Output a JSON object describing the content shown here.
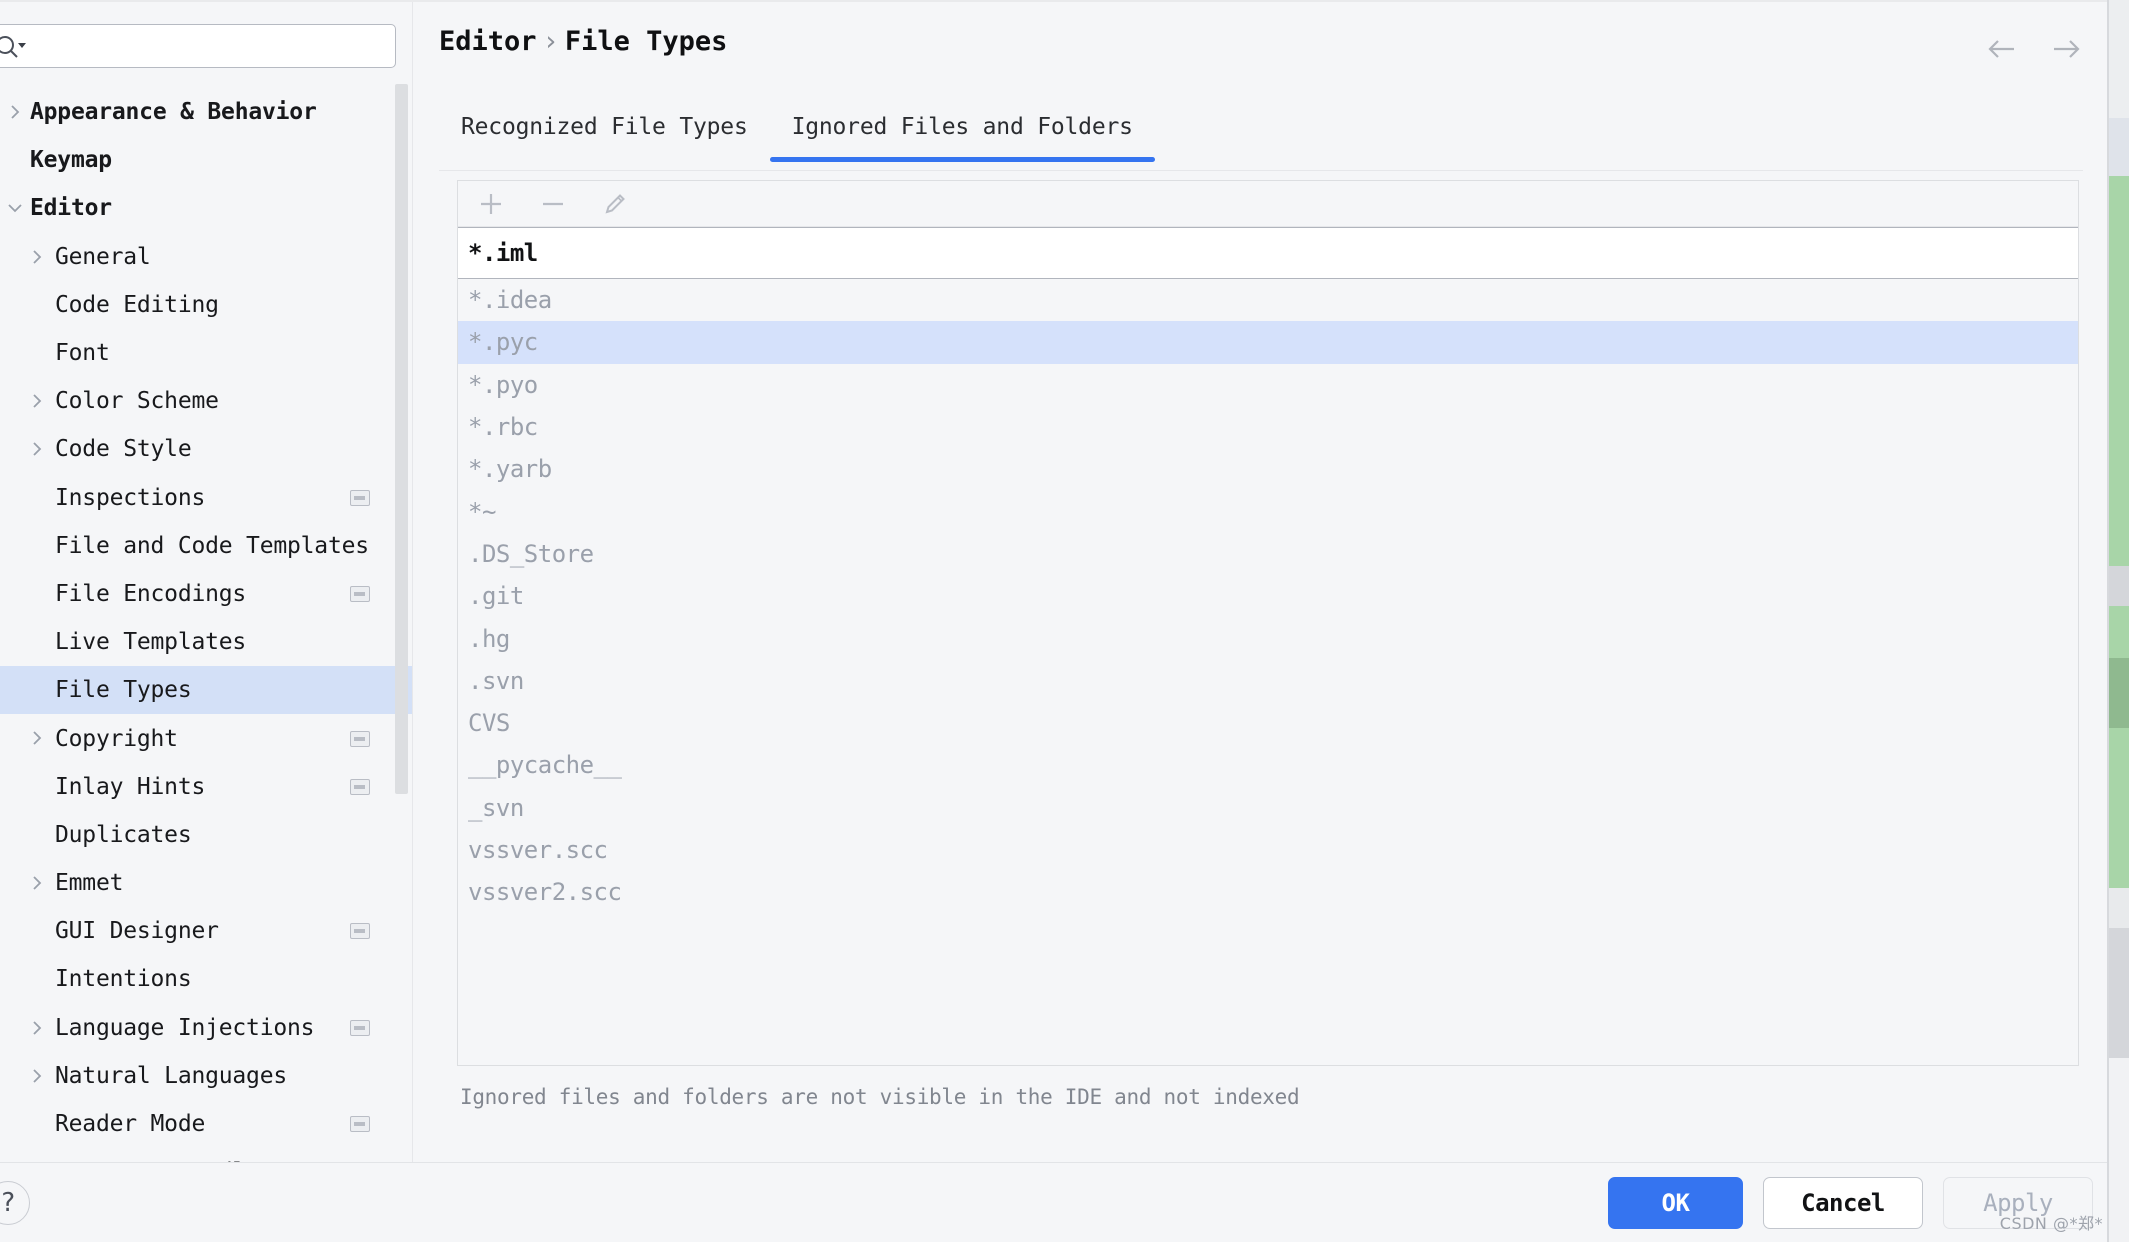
{
  "dialog": {
    "search": {
      "placeholder": "",
      "value": "",
      "icon": "search-icon"
    },
    "nav": {
      "back_icon": "arrow-left-icon",
      "forward_icon": "arrow-right-icon"
    },
    "help_label": "?"
  },
  "sidebar": {
    "items": [
      {
        "label": "Appearance & Behavior",
        "level": 0,
        "arrow": "chevron-right",
        "bold": true,
        "badge": false,
        "selected": false
      },
      {
        "label": "Keymap",
        "level": 0,
        "arrow": "none",
        "bold": true,
        "badge": false,
        "selected": false
      },
      {
        "label": "Editor",
        "level": 0,
        "arrow": "chevron-down",
        "bold": true,
        "badge": false,
        "selected": false
      },
      {
        "label": "General",
        "level": 1,
        "arrow": "chevron-right",
        "bold": false,
        "badge": false,
        "selected": false
      },
      {
        "label": "Code Editing",
        "level": 1,
        "arrow": "none",
        "bold": false,
        "badge": false,
        "selected": false
      },
      {
        "label": "Font",
        "level": 1,
        "arrow": "none",
        "bold": false,
        "badge": false,
        "selected": false
      },
      {
        "label": "Color Scheme",
        "level": 1,
        "arrow": "chevron-right",
        "bold": false,
        "badge": false,
        "selected": false
      },
      {
        "label": "Code Style",
        "level": 1,
        "arrow": "chevron-right",
        "bold": false,
        "badge": false,
        "selected": false
      },
      {
        "label": "Inspections",
        "level": 1,
        "arrow": "none",
        "bold": false,
        "badge": true,
        "selected": false
      },
      {
        "label": "File and Code Templates",
        "level": 1,
        "arrow": "none",
        "bold": false,
        "badge": false,
        "selected": false
      },
      {
        "label": "File Encodings",
        "level": 1,
        "arrow": "none",
        "bold": false,
        "badge": true,
        "selected": false
      },
      {
        "label": "Live Templates",
        "level": 1,
        "arrow": "none",
        "bold": false,
        "badge": false,
        "selected": false
      },
      {
        "label": "File Types",
        "level": 1,
        "arrow": "none",
        "bold": false,
        "badge": false,
        "selected": true
      },
      {
        "label": "Copyright",
        "level": 1,
        "arrow": "chevron-right",
        "bold": false,
        "badge": true,
        "selected": false
      },
      {
        "label": "Inlay Hints",
        "level": 1,
        "arrow": "none",
        "bold": false,
        "badge": true,
        "selected": false
      },
      {
        "label": "Duplicates",
        "level": 1,
        "arrow": "none",
        "bold": false,
        "badge": false,
        "selected": false
      },
      {
        "label": "Emmet",
        "level": 1,
        "arrow": "chevron-right",
        "bold": false,
        "badge": false,
        "selected": false
      },
      {
        "label": "GUI Designer",
        "level": 1,
        "arrow": "none",
        "bold": false,
        "badge": true,
        "selected": false
      },
      {
        "label": "Intentions",
        "level": 1,
        "arrow": "none",
        "bold": false,
        "badge": false,
        "selected": false
      },
      {
        "label": "Language Injections",
        "level": 1,
        "arrow": "chevron-right",
        "bold": false,
        "badge": true,
        "selected": false
      },
      {
        "label": "Natural Languages",
        "level": 1,
        "arrow": "chevron-right",
        "bold": false,
        "badge": false,
        "selected": false
      },
      {
        "label": "Reader Mode",
        "level": 1,
        "arrow": "none",
        "bold": false,
        "badge": true,
        "selected": false
      },
      {
        "label": "TextMate Bundl",
        "level": 1,
        "arrow": "none",
        "bold": false,
        "badge": false,
        "selected": false
      }
    ]
  },
  "main": {
    "breadcrumb": {
      "parent": "Editor",
      "separator": "›",
      "current": "File Types"
    },
    "tabs": [
      {
        "label": "Recognized File Types",
        "active": false
      },
      {
        "label": "Ignored Files and Folders",
        "active": true
      }
    ],
    "toolbar": [
      {
        "name": "add-button",
        "icon": "plus-icon",
        "enabled": false
      },
      {
        "name": "remove-button",
        "icon": "minus-icon",
        "enabled": false
      },
      {
        "name": "edit-button",
        "icon": "pencil-icon",
        "enabled": false
      }
    ],
    "editing_row": {
      "value": "*.iml"
    },
    "rows": [
      {
        "value": "*.idea",
        "selected": false
      },
      {
        "value": "*.pyc",
        "selected": true
      },
      {
        "value": "*.pyo",
        "selected": false
      },
      {
        "value": "*.rbc",
        "selected": false
      },
      {
        "value": "*.yarb",
        "selected": false
      },
      {
        "value": "*~",
        "selected": false
      },
      {
        "value": ".DS_Store",
        "selected": false
      },
      {
        "value": ".git",
        "selected": false
      },
      {
        "value": ".hg",
        "selected": false
      },
      {
        "value": ".svn",
        "selected": false
      },
      {
        "value": "CVS",
        "selected": false
      },
      {
        "value": "__pycache__",
        "selected": false
      },
      {
        "value": "_svn",
        "selected": false
      },
      {
        "value": "vssver.scc",
        "selected": false
      },
      {
        "value": "vssver2.scc",
        "selected": false
      }
    ],
    "hint": "Ignored files and folders are not visible in the IDE and not indexed"
  },
  "footer": {
    "ok_label": "OK",
    "cancel_label": "Cancel",
    "apply_label": "Apply"
  },
  "watermark": "CSDN @*郑*",
  "colors": {
    "accent": "#3574f0",
    "selection": "#d5e1fb",
    "tree_selection": "#d3e0f7",
    "panel_bg": "#f5f6f8",
    "list_text": "#9aa0ab",
    "ide_green": "#a8d5a8"
  }
}
